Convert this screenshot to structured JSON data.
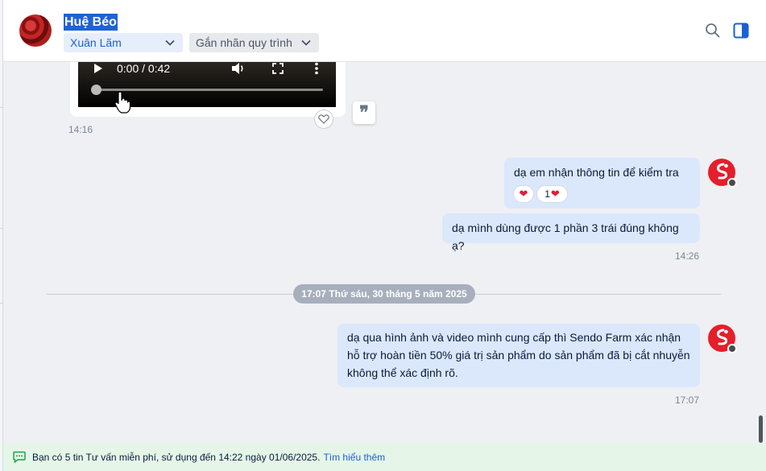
{
  "header": {
    "contact_name": "Huệ Béo",
    "assignee": "Xuân Lãm",
    "tag_placeholder": "Gắn nhãn quy trình"
  },
  "video_message": {
    "time_display": "0:00 / 0:42",
    "timestamp": "14:16",
    "progress_fraction": 0.0
  },
  "messages": [
    {
      "text": "dạ em nhận thông tin để kiểm tra ạ.",
      "reactions": [
        {
          "emoji": "❤",
          "count": ""
        },
        {
          "emoji": "❤",
          "count": "1"
        }
      ]
    },
    {
      "text": "dạ mình dùng được 1 phần 3 trái đúng không ạ?",
      "timestamp": "14:26"
    },
    {
      "text": "dạ qua hình ảnh và video mình cung cấp thì Sendo Farm xác nhận hỗ trợ hoàn tiền 50% giá trị sản phẩm do sản phẩm đã bị cắt nhuyễn không thể xác định rõ.",
      "timestamp": "17:07"
    }
  ],
  "date_separator": "17:07 Thứ sáu, 30 tháng 5 năm 2025",
  "footer": {
    "notice": "Bạn có 5 tin Tư vấn miễn phí, sử dụng đến 14:22 ngày 01/06/2025.",
    "link": "Tìm hiểu thêm"
  },
  "colors": {
    "accent": "#1a5fd6",
    "bubble": "#dbe7fb",
    "sender_brand": "#e41f2b",
    "footer_bg": "#e5f6e8"
  },
  "icons": [
    "search-icon",
    "side-panel-icon",
    "chevron-down-icon",
    "play-icon",
    "volume-icon",
    "fullscreen-icon",
    "more-vertical-icon",
    "heart-icon",
    "quote-icon",
    "chat-icon",
    "hand-cursor-icon"
  ]
}
